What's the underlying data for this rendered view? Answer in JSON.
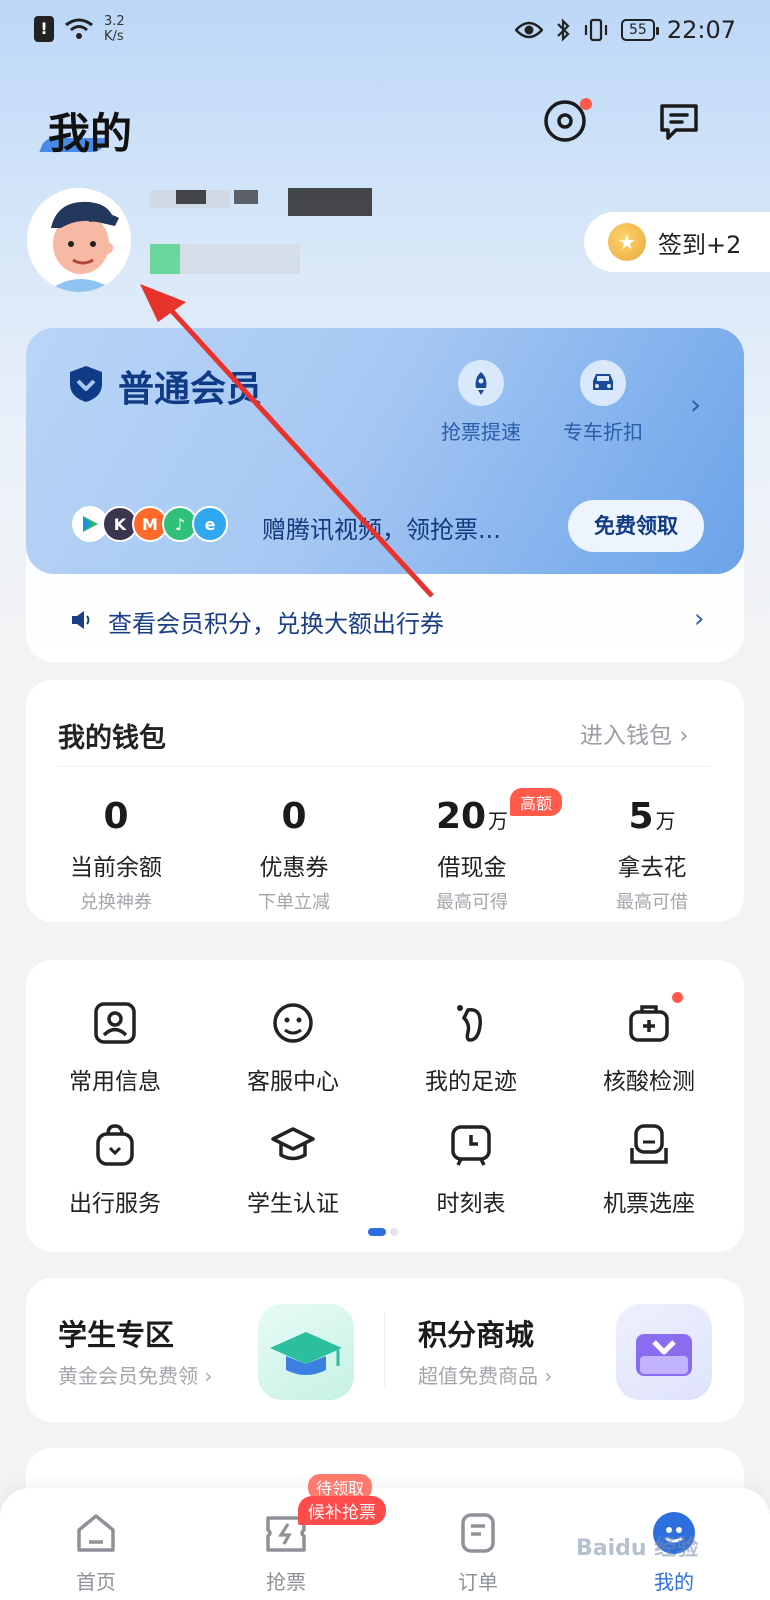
{
  "status_bar": {
    "speed": "3.2 K/s",
    "battery": "55",
    "time": "22:07"
  },
  "header": {
    "title": "我的",
    "icons": [
      "camera-icon",
      "message-icon"
    ]
  },
  "profile": {
    "checkin_label": "签到+2"
  },
  "member": {
    "title": "普通会员",
    "perks": [
      {
        "label": "抢票提速",
        "icon": "rocket-icon"
      },
      {
        "label": "专车折扣",
        "icon": "car-icon"
      }
    ],
    "promo_text": "赠腾讯视频，领抢票...",
    "claim_button": "免费领取",
    "points_text": "查看会员积分，兑换大额出行券"
  },
  "wallet": {
    "title": "我的钱包",
    "link": "进入钱包",
    "badge": "高额",
    "items": [
      {
        "value": "0",
        "unit": "",
        "label": "当前余额",
        "sub": "兑换神券"
      },
      {
        "value": "0",
        "unit": "",
        "label": "优惠券",
        "sub": "下单立减"
      },
      {
        "value": "20",
        "unit": "万",
        "label": "借现金",
        "sub": "最高可得"
      },
      {
        "value": "5",
        "unit": "万",
        "label": "拿去花",
        "sub": "最高可借"
      }
    ]
  },
  "services": [
    {
      "label": "常用信息",
      "icon": "id-card-icon"
    },
    {
      "label": "客服中心",
      "icon": "service-face-icon"
    },
    {
      "label": "我的足迹",
      "icon": "footprint-icon"
    },
    {
      "label": "核酸检测",
      "icon": "medical-kit-icon"
    },
    {
      "label": "出行服务",
      "icon": "bag-icon"
    },
    {
      "label": "学生认证",
      "icon": "graduation-cap-icon"
    },
    {
      "label": "时刻表",
      "icon": "clock-icon"
    },
    {
      "label": "机票选座",
      "icon": "seat-icon"
    }
  ],
  "zones": [
    {
      "title": "学生专区",
      "sub": "黄金会员免费领",
      "icon": "student-cap-icon"
    },
    {
      "title": "积分商城",
      "sub": "超值免费商品",
      "icon": "points-box-icon"
    }
  ],
  "tabs": [
    {
      "label": "首页",
      "icon": "home-icon"
    },
    {
      "label": "抢票",
      "icon": "lightning-ticket-icon",
      "badge": "候补抢票",
      "badge_back": "待领取"
    },
    {
      "label": "订单",
      "icon": "order-icon"
    },
    {
      "label": "我的",
      "icon": "mine-icon",
      "active": true
    }
  ],
  "watermark": "Baidu 经验",
  "colors": {
    "accent": "#2e6fe0",
    "member_dark": "#0f3a86",
    "badge_red": "#ff5a4a",
    "arrow_red": "#e8322c"
  }
}
